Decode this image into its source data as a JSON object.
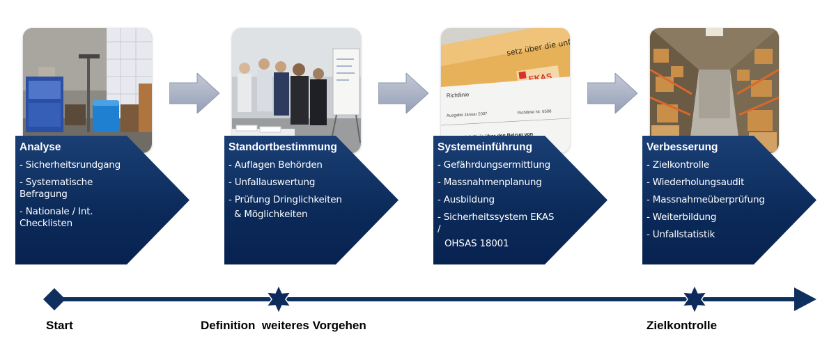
{
  "steps": [
    {
      "title": "Analyse",
      "items": [
        "- Sicherheitsrundgang",
        "- Systematische Befragung",
        "- Nationale / Int. Checklisten"
      ]
    },
    {
      "title": "Standortbestimmung",
      "items": [
        "- Auflagen Behörden",
        "- Unfallauswertung",
        "- Prüfung Dringlichkeiten",
        "& Möglichkeiten"
      ]
    },
    {
      "title": "Systemeinführung",
      "items": [
        "- Gefährdungsermittlung",
        "- Massnahmenplanung",
        "- Ausbildung",
        "- Sicherheitssystem EKAS /",
        "OHSAS 18001"
      ]
    },
    {
      "title": "Verbesserung",
      "items": [
        "- Zielkontrolle",
        "- Wiederholungsaudit",
        "- Massnahmeüberprüfung",
        "- Weiterbildung",
        "- Unfallstatistik"
      ]
    }
  ],
  "photos": {
    "doc_title": "EKAS",
    "doc_line1": "Ausgabe Januar 2007",
    "doc_line2": "Richtlinie Nr. 6508",
    "doc_line3": "Richtlinie über den Beizug von",
    "doc_banner": "Richtlinie",
    "doc_envelope": "setz über die unfallversicherung"
  },
  "timeline": {
    "start": "Start",
    "middle": "Definition  weiteres Vorgehen",
    "end": "Zielkontrolle"
  },
  "colors": {
    "navy": "#0b2a59",
    "grey_arrow": "#a7b0c4",
    "timeline": "#0f2f5f"
  }
}
